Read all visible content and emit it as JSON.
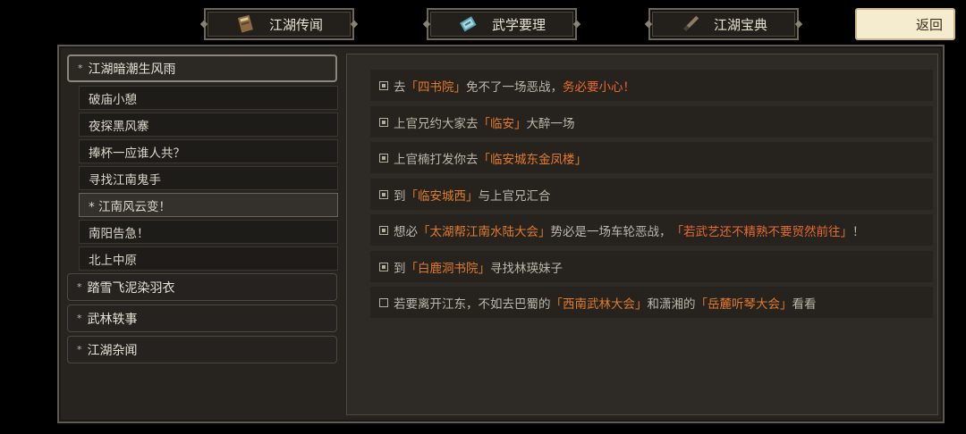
{
  "tabs": [
    {
      "label": "江湖传闻",
      "icon": "scroll-book-icon"
    },
    {
      "label": "武学要理",
      "icon": "manual-book-icon"
    },
    {
      "label": "江湖宝典",
      "icon": "brush-quill-icon"
    }
  ],
  "back_label": "返回",
  "categories": [
    {
      "bullet": "*",
      "label": "江湖暗潮生风雨"
    },
    {
      "bullet": "*",
      "label": "踏雪飞泥染羽衣"
    },
    {
      "bullet": "*",
      "label": "武林轶事"
    },
    {
      "bullet": "*",
      "label": "江湖杂闻"
    }
  ],
  "quests": [
    {
      "label": "破庙小憩"
    },
    {
      "label": "夜探黑风寨"
    },
    {
      "label": "捧杯一应谁人共？"
    },
    {
      "label": "寻找江南鬼手"
    },
    {
      "label": "* 江南风云变！"
    },
    {
      "label": "南阳告急！"
    },
    {
      "label": "北上中原"
    }
  ],
  "objectives": [
    {
      "done": true,
      "t": [
        "去",
        "「四书院」",
        "免不了一场恶战，",
        "务必要小心！"
      ]
    },
    {
      "done": true,
      "t": [
        "上官兄约大家去",
        "「临安」",
        "大醉一场"
      ]
    },
    {
      "done": true,
      "t": [
        "上官楠打发你去",
        "「临安城东金凤楼」"
      ]
    },
    {
      "done": true,
      "t": [
        "到",
        "「临安城西」",
        "与上官兄汇合"
      ]
    },
    {
      "done": true,
      "t": [
        "想必",
        "「太湖帮江南水陆大会」",
        "势必是一场车轮恶战，",
        "「若武艺还不精熟不要贸然前往」",
        "！"
      ]
    },
    {
      "done": true,
      "t": [
        "到",
        "「白鹿洞书院」",
        "寻找林瑛妹子"
      ]
    },
    {
      "done": false,
      "t": [
        "若要离开江东，不如去巴蜀的",
        "「西南武林大会」",
        "和潇湘的",
        "「岳麓听琴大会」",
        "看看"
      ]
    }
  ],
  "colors": {
    "highlight": "#e07b2c",
    "warning": "#e86a2e",
    "text": "#bdb7a9"
  }
}
